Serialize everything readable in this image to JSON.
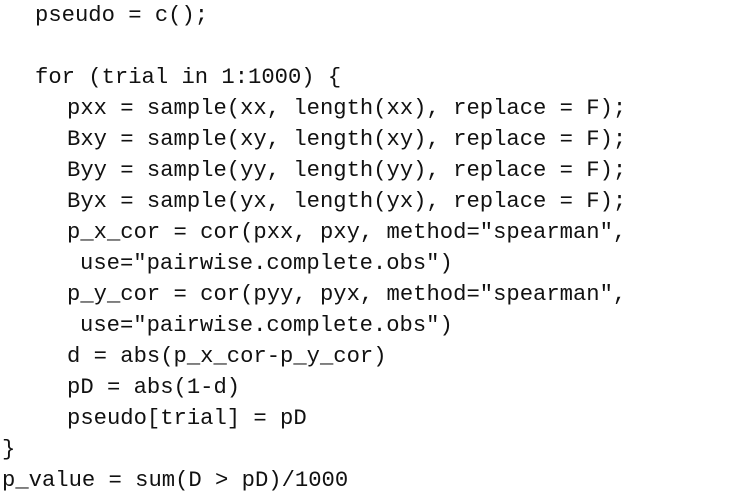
{
  "code": {
    "lines": [
      {
        "indent": 1,
        "text": "pseudo = c();"
      },
      {
        "indent": 0,
        "text": ""
      },
      {
        "indent": 1,
        "text": "for (trial in 1:1000) {"
      },
      {
        "indent": 2,
        "text": "pxx = sample(xx, length(xx), replace = F);"
      },
      {
        "indent": 2,
        "text": "Bxy = sample(xy, length(xy), replace = F);"
      },
      {
        "indent": 2,
        "text": "Byy = sample(yy, length(yy), replace = F);"
      },
      {
        "indent": 2,
        "text": "Byx = sample(yx, length(yx), replace = F);"
      },
      {
        "indent": 2,
        "text": "p_x_cor = cor(pxx, pxy, method=\"spearman\","
      },
      {
        "indent": 3,
        "text": "use=\"pairwise.complete.obs\")"
      },
      {
        "indent": 2,
        "text": "p_y_cor = cor(pyy, pyx, method=\"spearman\","
      },
      {
        "indent": 3,
        "text": "use=\"pairwise.complete.obs\")"
      },
      {
        "indent": 2,
        "text": "d = abs(p_x_cor-p_y_cor)"
      },
      {
        "indent": 2,
        "text": "pD = abs(1-d)"
      },
      {
        "indent": 2,
        "text": "pseudo[trial] = pD"
      },
      {
        "indent": 0,
        "text": "}"
      },
      {
        "indent": 0,
        "text": "p_value = sum(D > pD)/1000"
      }
    ]
  }
}
